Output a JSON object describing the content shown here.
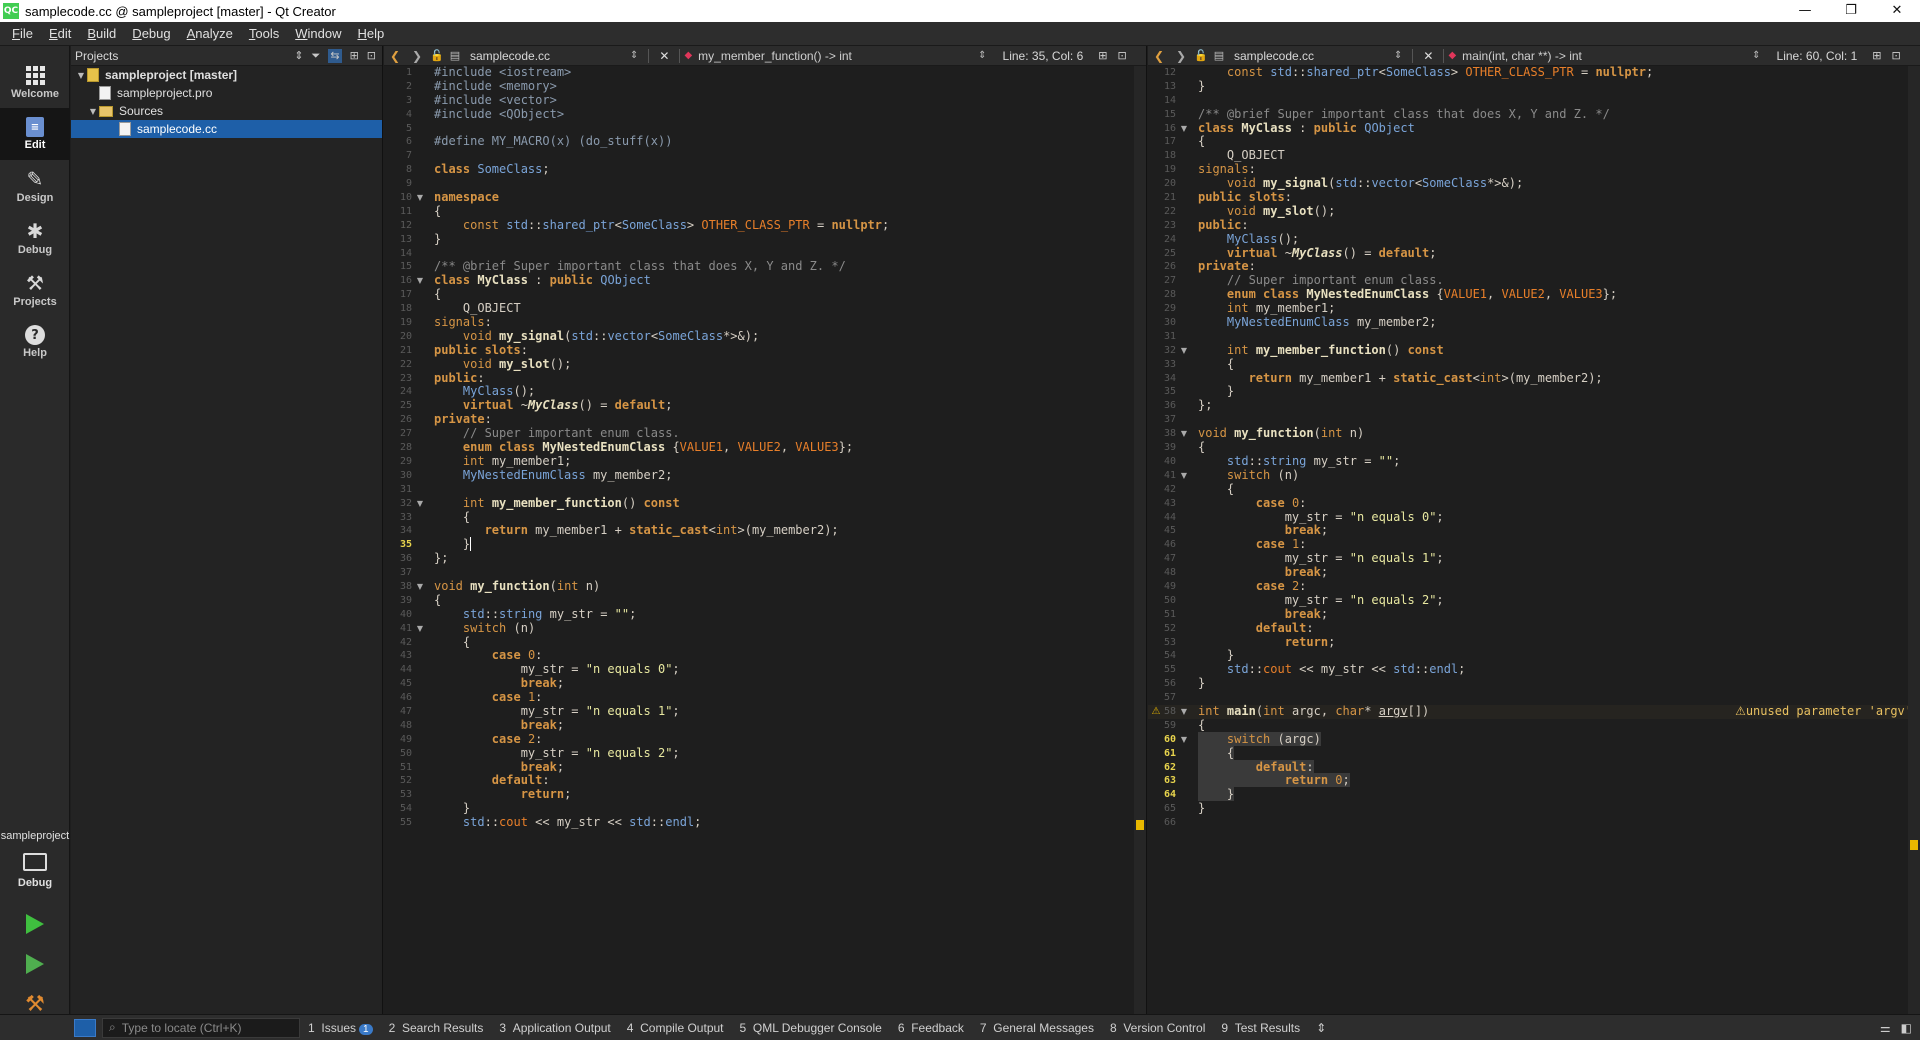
{
  "window": {
    "title": "samplecode.cc @ sampleproject [master] - Qt Creator",
    "app_icon": "QC",
    "controls": [
      "—",
      "❐",
      "✕"
    ]
  },
  "menu": [
    "File",
    "Edit",
    "Build",
    "Debug",
    "Analyze",
    "Tools",
    "Window",
    "Help"
  ],
  "modes": [
    {
      "label": "Welcome",
      "icon": "grid-icon"
    },
    {
      "label": "Edit",
      "icon": "edit-icon",
      "active": true
    },
    {
      "label": "Design",
      "icon": "pencil-icon"
    },
    {
      "label": "Debug",
      "icon": "bug-icon"
    },
    {
      "label": "Projects",
      "icon": "wrench-icon"
    },
    {
      "label": "Help",
      "icon": "help-icon"
    }
  ],
  "kit": {
    "project": "sampleproject",
    "config": "Debug"
  },
  "projects_pane": {
    "title": "Projects",
    "tree": [
      {
        "label": "sampleproject [master]",
        "level": 0,
        "type": "project",
        "expanded": true
      },
      {
        "label": "sampleproject.pro",
        "level": 1,
        "type": "file"
      },
      {
        "label": "Sources",
        "level": 1,
        "type": "folder",
        "expanded": true
      },
      {
        "label": "samplecode.cc",
        "level": 2,
        "type": "file",
        "selected": true
      }
    ]
  },
  "editor_left": {
    "document": "samplecode.cc",
    "symbol": "my_member_function() -> int",
    "position": "Line: 35, Col: 6",
    "current_line": 35
  },
  "editor_right": {
    "document": "samplecode.cc",
    "symbol": "main(int, char **) -> int",
    "position": "Line: 60, Col: 1",
    "warning": "unused parameter 'argv'"
  },
  "output_bar": {
    "locator_placeholder": "Type to locate (Ctrl+K)",
    "tabs": [
      {
        "num": "1",
        "label": "Issues",
        "badge": "1"
      },
      {
        "num": "2",
        "label": "Search Results"
      },
      {
        "num": "3",
        "label": "Application Output"
      },
      {
        "num": "4",
        "label": "Compile Output"
      },
      {
        "num": "5",
        "label": "QML Debugger Console"
      },
      {
        "num": "6",
        "label": "Feedback"
      },
      {
        "num": "7",
        "label": "General Messages"
      },
      {
        "num": "8",
        "label": "Version Control"
      },
      {
        "num": "9",
        "label": "Test Results"
      }
    ]
  },
  "colors": {
    "accent": "#1e5fa8",
    "keyword": "#d69545",
    "warning": "#e8b800",
    "run": "#3fbf3f"
  }
}
